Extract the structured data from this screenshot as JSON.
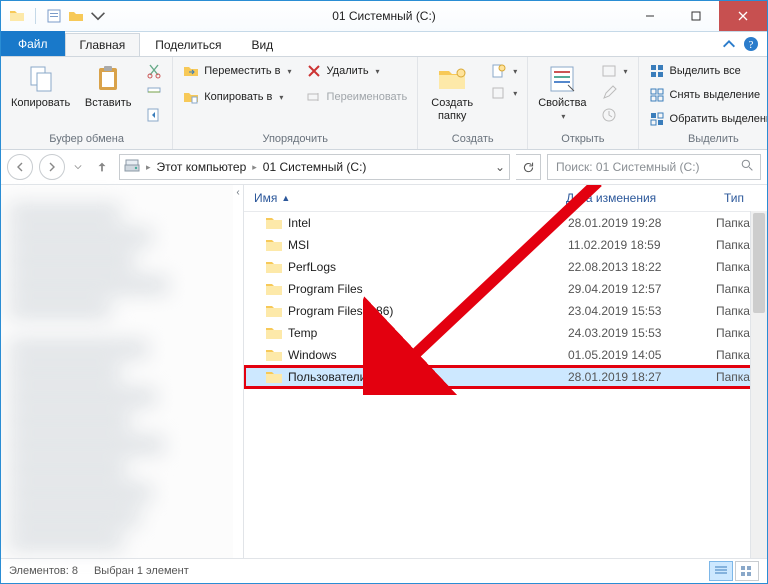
{
  "title": "01 Системный (C:)",
  "tabs": {
    "file": "Файл",
    "home": "Главная",
    "share": "Поделиться",
    "view": "Вид"
  },
  "ribbon": {
    "clipboard": {
      "label": "Буфер обмена",
      "copy": "Копировать",
      "paste": "Вставить"
    },
    "organize": {
      "label": "Упорядочить",
      "moveTo": "Переместить в",
      "copyTo": "Копировать в",
      "delete": "Удалить",
      "rename": "Переименовать"
    },
    "create": {
      "label": "Создать",
      "newFolder": "Создать\nпапку"
    },
    "open": {
      "label": "Открыть",
      "properties": "Свойства"
    },
    "select": {
      "label": "Выделить",
      "all": "Выделить все",
      "none": "Снять выделение",
      "invert": "Обратить выделение"
    }
  },
  "breadcrumb": {
    "thisPc": "Этот компьютер",
    "drive": "01 Системный (C:)"
  },
  "search": {
    "placeholder": "Поиск: 01 Системный (C:)"
  },
  "columns": {
    "name": "Имя",
    "date": "Дата изменения",
    "type": "Тип"
  },
  "rows": [
    {
      "name": "Intel",
      "date": "28.01.2019 19:28",
      "type": "Папка с ф"
    },
    {
      "name": "MSI",
      "date": "11.02.2019 18:59",
      "type": "Папка с ф"
    },
    {
      "name": "PerfLogs",
      "date": "22.08.2013 18:22",
      "type": "Папка с ф"
    },
    {
      "name": "Program Files",
      "date": "29.04.2019 12:57",
      "type": "Папка с ф"
    },
    {
      "name": "Program Files (x86)",
      "date": "23.04.2019 15:53",
      "type": "Папка с ф"
    },
    {
      "name": "Temp",
      "date": "24.03.2019 15:53",
      "type": "Папка с ф"
    },
    {
      "name": "Windows",
      "date": "01.05.2019 14:05",
      "type": "Папка с ф"
    },
    {
      "name": "Пользователи",
      "date": "28.01.2019 18:27",
      "type": "Папка с ф"
    }
  ],
  "status": {
    "count": "Элементов: 8",
    "selected": "Выбран 1 элемент"
  },
  "colors": {
    "accent": "#1979ca",
    "highlight": "#cde8ff",
    "annotation": "#e3000f"
  }
}
